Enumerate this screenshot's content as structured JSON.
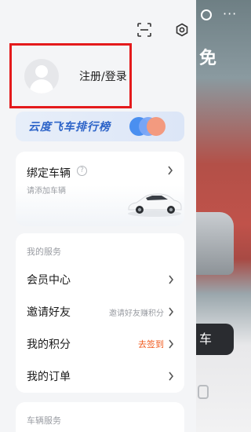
{
  "colors": {
    "accent_blue": "#2c63c8",
    "highlight_red": "#e41a1c",
    "orange": "#f05a1e"
  },
  "header": {
    "scan_icon": "scan-icon",
    "settings_icon": "settings-icon"
  },
  "profile": {
    "login_label": "注册/登录",
    "avatar_icon": "user-avatar-icon"
  },
  "rank_banner": {
    "label": "云度飞车排行榜"
  },
  "bind_vehicle": {
    "title": "绑定车辆",
    "help_glyph": "?",
    "subtitle": "请添加车辆"
  },
  "services": {
    "section_label": "我的服务",
    "items": [
      {
        "label": "会员中心",
        "extra": ""
      },
      {
        "label": "邀请好友",
        "extra": "邀请好友赚积分"
      },
      {
        "label": "我的积分",
        "extra": "去签到"
      },
      {
        "label": "我的订单",
        "extra": ""
      }
    ]
  },
  "vehicle_services": {
    "section_label": "车辆服务"
  },
  "background": {
    "title_fragment": "免",
    "button_fragment": "车",
    "more_glyph": "···"
  }
}
